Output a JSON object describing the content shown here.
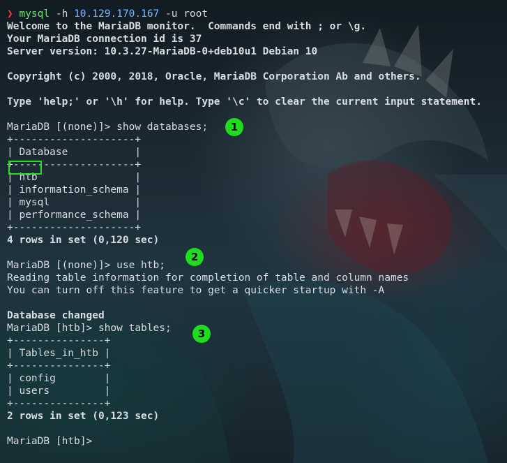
{
  "command": {
    "arrow": "❯",
    "name": "mysql",
    "flag_host": "-h",
    "ip": "10.129.170.167",
    "flag_user": "-u root"
  },
  "lines": [
    "Welcome to the MariaDB monitor.  Commands end with ; or \\g.",
    "Your MariaDB connection id is 37",
    "Server version: 10.3.27-MariaDB-0+deb10u1 Debian 10",
    "",
    "Copyright (c) 2000, 2018, Oracle, MariaDB Corporation Ab and others.",
    "",
    "Type 'help;' or '\\h' for help. Type '\\c' to clear the current input statement.",
    "",
    "MariaDB [(none)]> show databases;",
    "+--------------------+",
    "| Database           |",
    "+--------------------+",
    "| htb                |",
    "| information_schema |",
    "| mysql              |",
    "| performance_schema |",
    "+--------------------+",
    "4 rows in set (0,120 sec)",
    "",
    "MariaDB [(none)]> use htb;",
    "Reading table information for completion of table and column names",
    "You can turn off this feature to get a quicker startup with -A",
    "",
    "Database changed",
    "MariaDB [htb]> show tables;",
    "+---------------+",
    "| Tables_in_htb |",
    "+---------------+",
    "| config        |",
    "| users         |",
    "+---------------+",
    "2 rows in set (0,123 sec)",
    "",
    "MariaDB [htb]>"
  ],
  "badges": [
    "1",
    "2",
    "3"
  ]
}
